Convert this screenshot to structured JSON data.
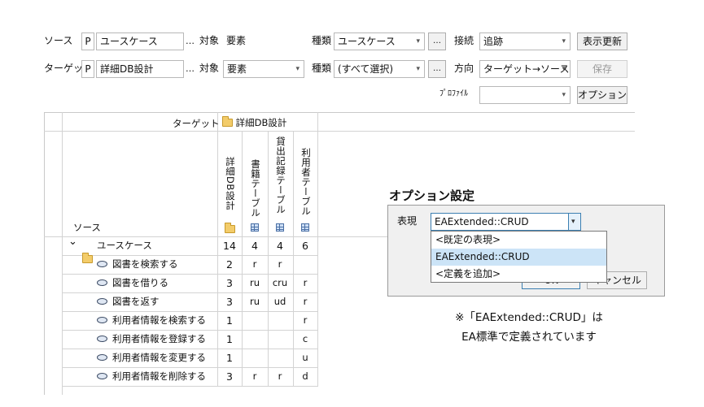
{
  "toolbar": {
    "source_label": "ソース",
    "source_type": "P",
    "source_value": "ユースケース",
    "ellipsis": "…",
    "target_kind_label": "対象",
    "source_target_value": "要素",
    "kind_label": "種類",
    "source_kind_value": "ユースケース",
    "connection_label": "接続",
    "connection_value": "追跡",
    "refresh_button": "表示更新",
    "target_label": "ターゲット",
    "target_type": "P",
    "target_value": "詳細DB設計",
    "target_target_value": "要素",
    "target_kind_value": "(すべて選択)",
    "direction_label": "方向",
    "direction_value": "ターゲット→ソース",
    "save_button": "保存",
    "profile_label": "ﾌﾟﾛﾌｧｲﾙ",
    "profile_value": "",
    "options_button": "オプション"
  },
  "grid": {
    "target_header": "ターゲット",
    "target_package": "詳細DB設計",
    "source_header": "ソース",
    "columns": [
      "詳細DB設計",
      "書籍テーブル",
      "貸出記録テーブル",
      "利用者テーブル"
    ],
    "rows": [
      {
        "name": "ユースケース",
        "kind": "package",
        "cells": [
          "14",
          "4",
          "4",
          "6"
        ]
      },
      {
        "name": "図書を検索する",
        "kind": "usecase",
        "cells": [
          "2",
          "r",
          "r",
          ""
        ]
      },
      {
        "name": "図書を借りる",
        "kind": "usecase",
        "cells": [
          "3",
          "ru",
          "cru",
          "r"
        ]
      },
      {
        "name": "図書を返す",
        "kind": "usecase",
        "cells": [
          "3",
          "ru",
          "ud",
          "r"
        ]
      },
      {
        "name": "利用者情報を検索する",
        "kind": "usecase",
        "cells": [
          "1",
          "",
          "",
          "r"
        ]
      },
      {
        "name": "利用者情報を登録する",
        "kind": "usecase",
        "cells": [
          "1",
          "",
          "",
          "c"
        ]
      },
      {
        "name": "利用者情報を変更する",
        "kind": "usecase",
        "cells": [
          "1",
          "",
          "",
          "u"
        ]
      },
      {
        "name": "利用者情報を削除する",
        "kind": "usecase",
        "cells": [
          "3",
          "r",
          "r",
          "d"
        ]
      }
    ]
  },
  "dialog": {
    "title": "オプション設定",
    "repr_label": "表現",
    "repr_value": "EAExtended::CRUD",
    "options": [
      "<既定の表現>",
      "EAExtended::CRUD",
      "<定義を追加>"
    ],
    "selected_index": 1,
    "ok_button": "OK",
    "cancel_button": "キャンセル"
  },
  "note": {
    "line1": "※「EAExtended::CRUD」は",
    "line2": "EA標準で定義されています"
  }
}
